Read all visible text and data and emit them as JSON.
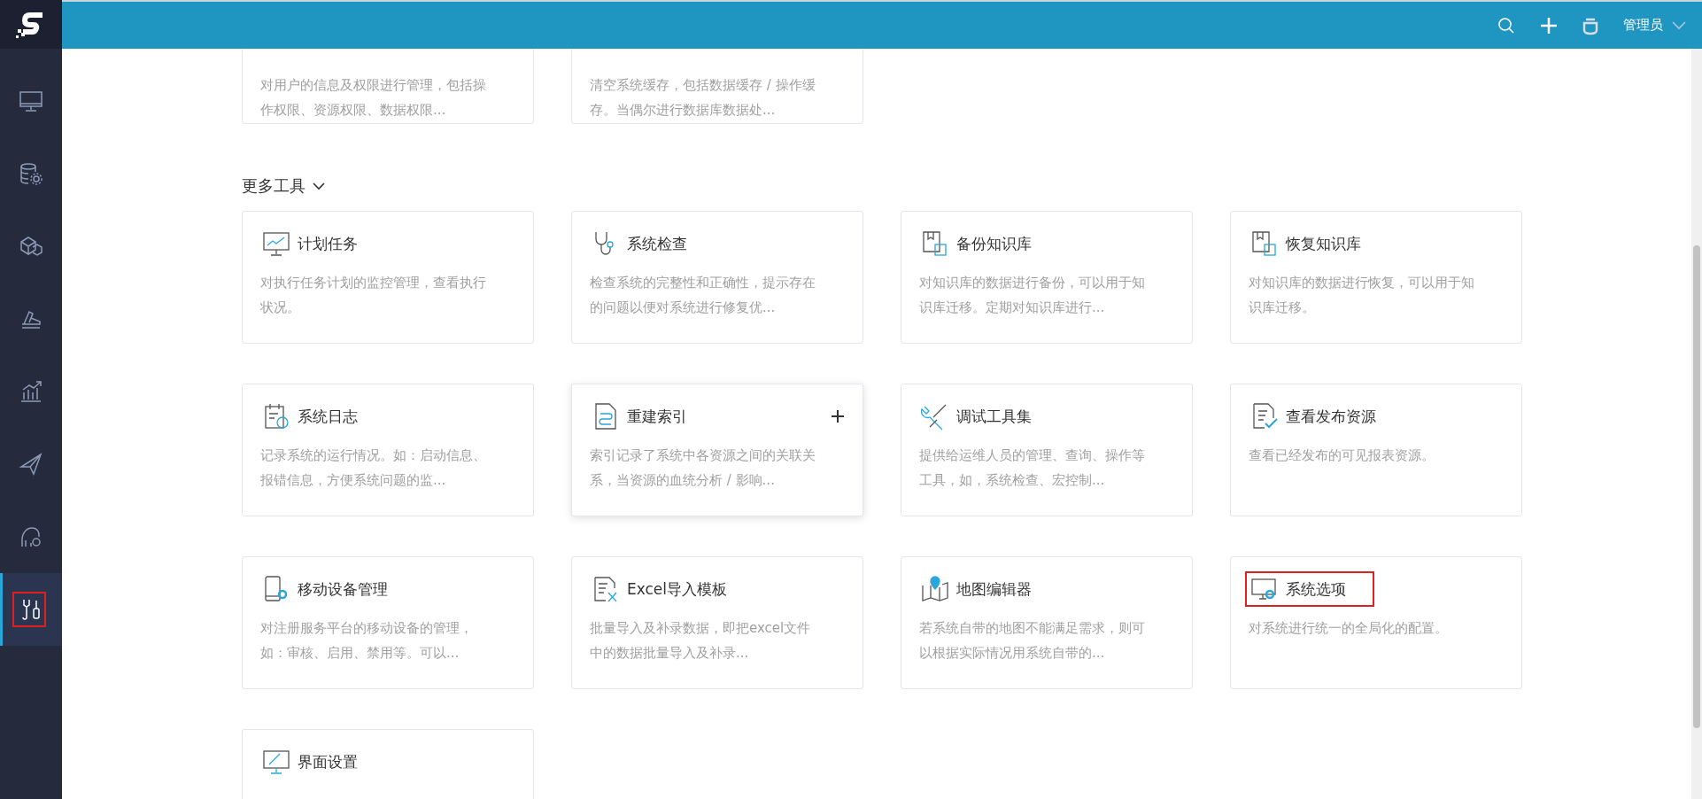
{
  "topbar": {
    "user": "管理员"
  },
  "sidebar": {
    "items": [
      {
        "selected": false,
        "highlighted": false
      },
      {
        "selected": false,
        "highlighted": false
      },
      {
        "selected": false,
        "highlighted": false
      },
      {
        "selected": false,
        "highlighted": false
      },
      {
        "selected": false,
        "highlighted": false
      },
      {
        "selected": false,
        "highlighted": false
      },
      {
        "selected": false,
        "highlighted": false
      },
      {
        "selected": true,
        "highlighted": true
      }
    ]
  },
  "top_cards": [
    {
      "description": "对用户的信息及权限进行管理，包括操作权限、资源权限、数据权限..."
    },
    {
      "description": "清空系统缓存，包括数据缓存 / 操作缓存。当偶尔进行数据库数据处..."
    }
  ],
  "section": {
    "title": "更多工具",
    "expanded": true
  },
  "cards": [
    {
      "title": "计划任务",
      "description": "对执行任务计划的监控管理，查看执行状况。",
      "hovered": false,
      "highlighted": false
    },
    {
      "title": "系统检查",
      "description": "检查系统的完整性和正确性，提示存在的问题以便对系统进行修复优...",
      "hovered": false,
      "highlighted": false
    },
    {
      "title": "备份知识库",
      "description": "对知识库的数据进行备份，可以用于知识库迁移。定期对知识库进行...",
      "hovered": false,
      "highlighted": false
    },
    {
      "title": "恢复知识库",
      "description": "对知识库的数据进行恢复，可以用于知识库迁移。",
      "hovered": false,
      "highlighted": false
    },
    {
      "title": "系统日志",
      "description": "记录系统的运行情况。如：启动信息、报错信息，方便系统问题的监...",
      "hovered": false,
      "highlighted": false
    },
    {
      "title": "重建索引",
      "description": "索引记录了系统中各资源之间的关联关系，当资源的血统分析 / 影响...",
      "hovered": true,
      "highlighted": false
    },
    {
      "title": "调试工具集",
      "description": "提供给运维人员的管理、查询、操作等工具，如，系统检查、宏控制...",
      "hovered": false,
      "highlighted": false
    },
    {
      "title": "查看发布资源",
      "description": "查看已经发布的可见报表资源。",
      "hovered": false,
      "highlighted": false
    },
    {
      "title": "移动设备管理",
      "description": "对注册服务平台的移动设备的管理，如：审核、启用、禁用等。可以...",
      "hovered": false,
      "highlighted": false
    },
    {
      "title": "Excel导入模板",
      "description": "批量导入及补录数据，即把excel文件中的数据批量导入及补录...",
      "hovered": false,
      "highlighted": false
    },
    {
      "title": "地图编辑器",
      "description": "若系统自带的地图不能满足需求，则可以根据实际情况用系统自带的...",
      "hovered": false,
      "highlighted": false
    },
    {
      "title": "系统选项",
      "description": "对系统进行统一的全局化的配置。",
      "hovered": false,
      "highlighted": true
    },
    {
      "title": "界面设置",
      "hovered": false,
      "highlighted": false
    }
  ]
}
